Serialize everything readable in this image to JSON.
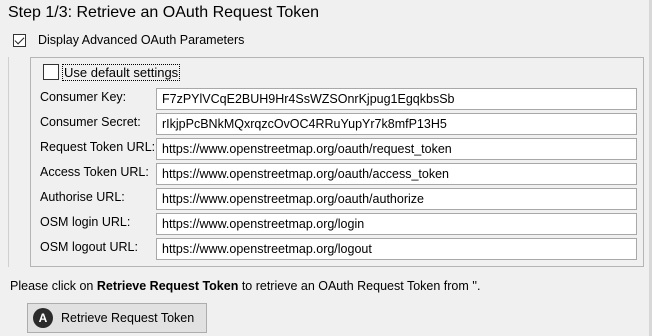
{
  "step_title": "Step 1/3: Retrieve an OAuth Request Token",
  "display_advanced": {
    "label": "Display Advanced OAuth Parameters",
    "checked": true
  },
  "use_default": {
    "label": "Use default settings",
    "checked": false
  },
  "fields": [
    {
      "label": "Consumer Key:",
      "value": "F7zPYlVCqE2BUH9Hr4SsWZSOnrKjpug1EgqkbsSb"
    },
    {
      "label": "Consumer Secret:",
      "value": "rIkjpPcBNkMQxrqzcOvOC4RRuYupYr7k8mfP13H5"
    },
    {
      "label": "Request Token URL:",
      "value": "https://www.openstreetmap.org/oauth/request_token"
    },
    {
      "label": "Access Token URL:",
      "value": "https://www.openstreetmap.org/oauth/access_token"
    },
    {
      "label": "Authorise URL:",
      "value": "https://www.openstreetmap.org/oauth/authorize"
    },
    {
      "label": "OSM login URL:",
      "value": "https://www.openstreetmap.org/login"
    },
    {
      "label": "OSM logout URL:",
      "value": "https://www.openstreetmap.org/logout"
    }
  ],
  "instruction": {
    "prefix": "Please click on ",
    "bold": "Retrieve Request Token",
    "suffix": " to retrieve an OAuth Request Token from ''."
  },
  "retrieve_button": {
    "label": "Retrieve Request Token",
    "icon": "josm-logo-icon",
    "icon_glyph": "A"
  }
}
